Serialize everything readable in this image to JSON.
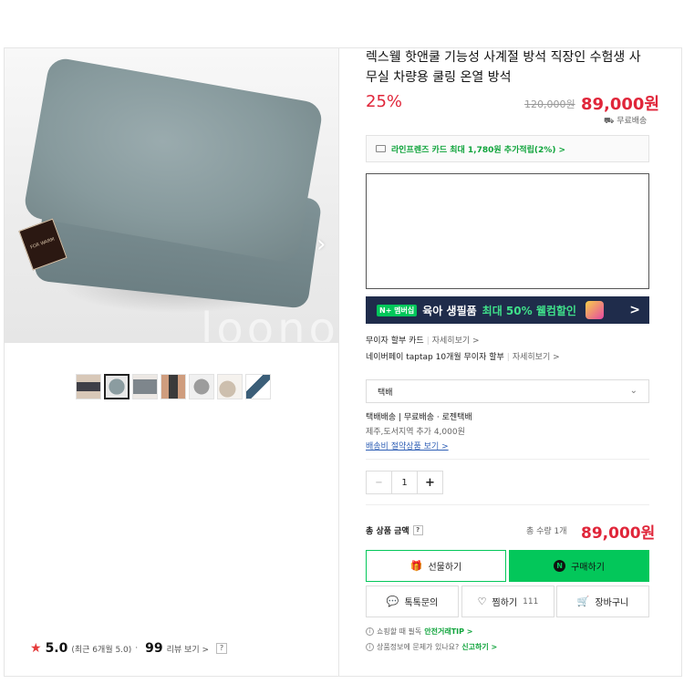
{
  "gallery": {
    "watermark": "loono",
    "brand_tag": "FOR WARM",
    "thumbnails": [
      "thumb-1",
      "thumb-2",
      "thumb-3",
      "thumb-4",
      "thumb-5",
      "thumb-6",
      "thumb-7"
    ],
    "active_index": 1
  },
  "review": {
    "score": "5.0",
    "period": "(최근 6개월 5.0)",
    "count": "99",
    "count_label": "리뷰 보기 >",
    "help": "?"
  },
  "product": {
    "title": "렉스웰 핫앤쿨 기능성 사계절 방석 직장인 수험생 사무실 차량용 쿨링 온열 방석",
    "discount": "25%",
    "original_price": "120,000원",
    "price": "89,000원",
    "shipping_free": "무료배송"
  },
  "benefits": {
    "card_text": "라인프렌즈 카드 최대 1,780원 추가적립(2%) >",
    "promo_badge": "N+ 멤버십",
    "promo_text": "육아 생필품",
    "promo_highlight": "최대 50% 웰컴할인",
    "promo_chevron": ">",
    "installment_label": "무이자 할부 카드",
    "installment_link": "자세히보기 >",
    "npay_label": "네이버페이 taptap 10개월 무이자 할부",
    "npay_link": "자세히보기 >"
  },
  "delivery": {
    "select_value": "택배",
    "line1": "택배배송 | 무료배송 · 로젠택배",
    "line2": "제주,도서지역 추가 4,000원",
    "link": "배송비 절약상품 보기 >"
  },
  "quantity": {
    "minus": "−",
    "value": "1",
    "plus": "+"
  },
  "total": {
    "label": "총 상품 금액",
    "help": "?",
    "qty_text": "총 수량 1개",
    "price": "89,000원"
  },
  "actions": {
    "gift_label": "선물하기",
    "buy_label": "구매하기",
    "buy_badge": "N",
    "talk_label": "톡톡문의",
    "wish_label": "찜하기",
    "wish_count": "111",
    "cart_label": "장바구니"
  },
  "tips": {
    "tip1_text": "쇼핑할 때 필독",
    "tip1_link": "안전거래TIP >",
    "tip2_text": "상품정보에 문제가 있나요?",
    "tip2_link": "신고하기 >"
  },
  "colors": {
    "accent_green": "#03c75a",
    "price_red": "#e0263a",
    "promo_navy": "#1f2c4b"
  }
}
